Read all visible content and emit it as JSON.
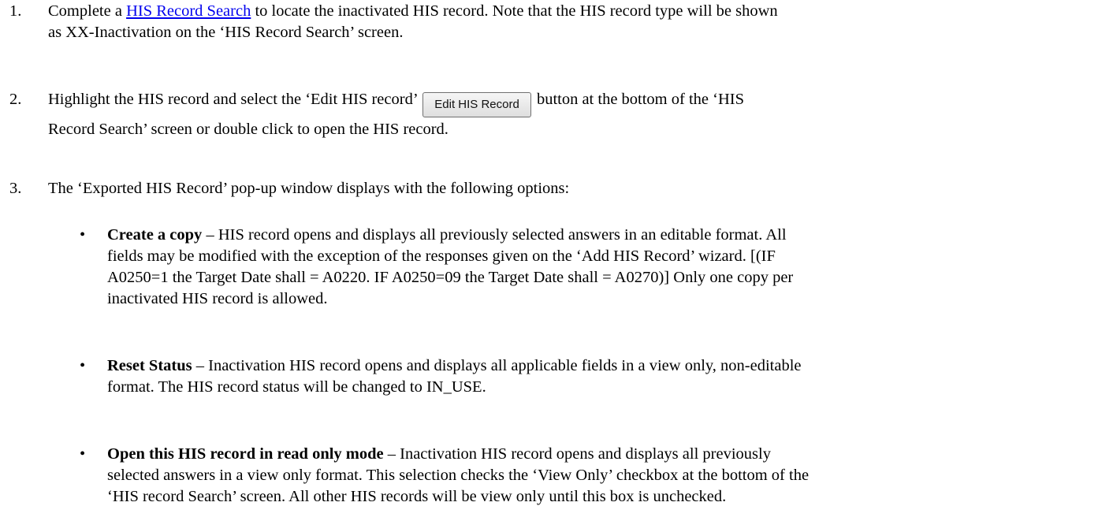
{
  "steps": [
    {
      "number": "1.",
      "line1_link": "HIS Record Search",
      "line1_rest": " to locate the inactivated HIS record. Note that the HIS record type will be shown",
      "line1_prefix": "Complete a ",
      "line2": "as XX-Inactivation on the ‘HIS Record Search’ screen."
    },
    {
      "number": "2.",
      "line1_before": "Highlight the HIS record and select the ‘Edit HIS record’",
      "button_label": "Edit HIS Record",
      "line1_after": "button at the bottom of the ‘HIS",
      "line2": "Record Search’ screen or double click to open the HIS record."
    },
    {
      "number": "3.",
      "line1": "The ‘Exported HIS Record’ pop-up window displays with the following options:"
    }
  ],
  "bullet_glyph": "•",
  "options": [
    {
      "title": "Create a copy",
      "lines": [
        " – HIS record opens and displays all previously selected answers in an editable format.  All",
        "fields may be modified with the exception of the responses given on the ‘Add HIS Record’ wizard. [(IF",
        "A0250=1 the Target Date shall = A0220. IF A0250=09 the Target Date shall = A0270)] Only one copy per",
        "inactivated HIS record is allowed."
      ]
    },
    {
      "title": "Reset Status",
      "lines": [
        " – Inactivation HIS record opens and displays all applicable fields in a view only, non-editable",
        "format.  The HIS record status will be changed to IN_USE."
      ]
    },
    {
      "title": "Open this HIS record in read only mode",
      "lines": [
        " – Inactivation HIS record opens and displays all previously",
        "selected answers in a view only format.  This selection checks the ‘View Only’ checkbox at the bottom of the",
        "‘HIS record Search’ screen.  All other HIS records will be view only until this box is unchecked."
      ]
    }
  ]
}
